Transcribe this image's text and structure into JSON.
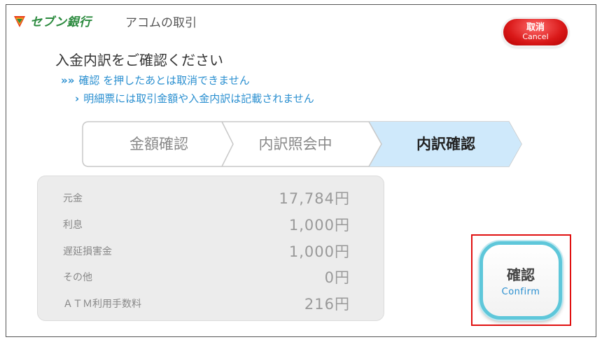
{
  "header": {
    "brand": "セブン銀行",
    "title": "アコムの取引",
    "cancel_jp": "取消",
    "cancel_en": "Cancel"
  },
  "main": {
    "heading": "入金内訳をご確認ください",
    "notice_1_arrow": "»»",
    "notice_1": "確認 を押したあとは取消できません",
    "notice_2_arrow": "›",
    "notice_2": "明細票には取引金額や入金内訳は記載されません"
  },
  "steps": [
    {
      "label": "金額確認",
      "active": false
    },
    {
      "label": "内訳照会中",
      "active": false
    },
    {
      "label": "内訳確認",
      "active": true
    }
  ],
  "breakdown": [
    {
      "label": "元金",
      "amount": "17,784円"
    },
    {
      "label": "利息",
      "amount": "1,000円"
    },
    {
      "label": "遅延損害金",
      "amount": "1,000円"
    },
    {
      "label": "その他",
      "amount": "0円"
    },
    {
      "label": "ＡＴＭ利用手数料",
      "amount": "216円"
    }
  ],
  "confirm": {
    "jp": "確認",
    "en": "Confirm"
  },
  "colors": {
    "brand_green": "#2b8a3e",
    "accent_blue": "#2a8fd0",
    "active_step": "#cfe9fb",
    "cancel_red": "#d91818",
    "highlight_red": "#e01010",
    "confirm_ring": "#5ec7da"
  }
}
